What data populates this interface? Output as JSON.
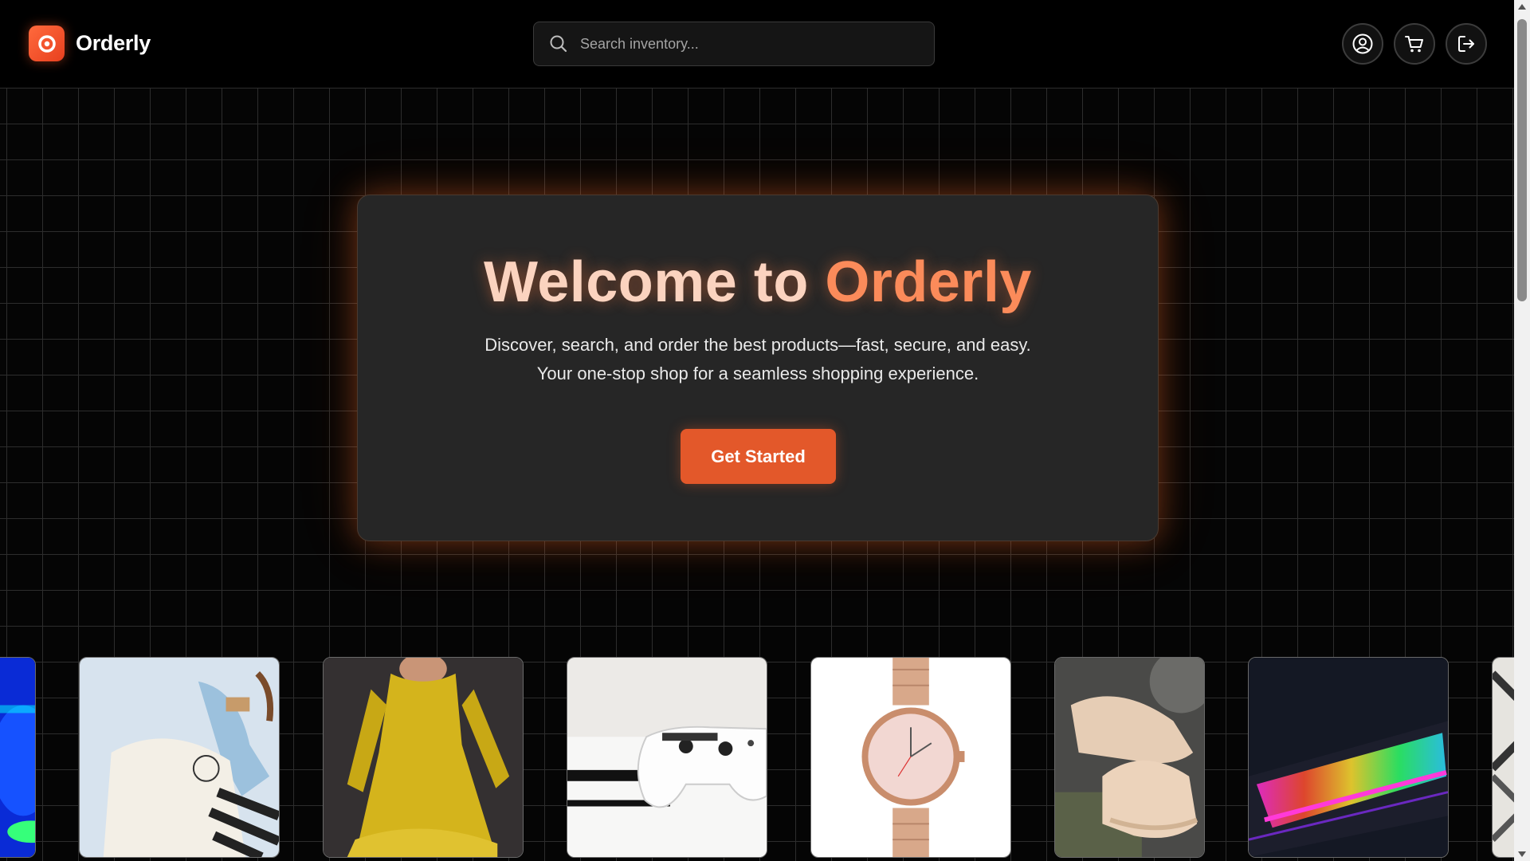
{
  "header": {
    "brand_name": "Orderly",
    "search_placeholder": "Search inventory...",
    "actions": [
      "user-account-icon",
      "cart-icon",
      "logout-icon"
    ]
  },
  "hero": {
    "title_part1": "Welcome to ",
    "title_part2": "Orderly",
    "subtitle_line1": "Discover, search, and order the best products—fast, secure, and easy.",
    "subtitle_line2": "Your one-stop shop for a seamless shopping experience.",
    "cta_label": "Get Started"
  },
  "carousel": {
    "products": [
      "rgb-device-image",
      "sweater-jeans-image",
      "yellow-dress-image",
      "game-controller-image",
      "wristwatch-image",
      "sneakers-image",
      "rgb-keyboard-image",
      "partial-product-image"
    ]
  },
  "colors": {
    "accent": "#e3582a",
    "title_light": "#fbd3bf",
    "title_accent": "#fb8b5a",
    "background": "#000000",
    "card_bg": "#262626"
  }
}
